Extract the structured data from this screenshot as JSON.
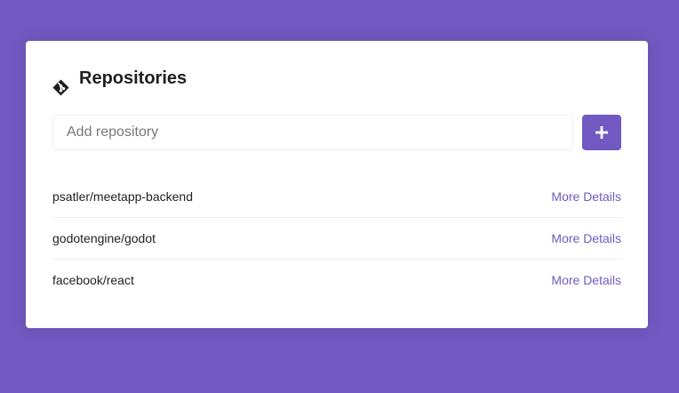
{
  "colors": {
    "background": "#7159c1",
    "accent": "#7159c1",
    "card": "#ffffff"
  },
  "header": {
    "icon": "git-icon",
    "title": "Repositories"
  },
  "form": {
    "placeholder": "Add repository",
    "value": "",
    "submit_icon": "plus-icon"
  },
  "repositories": [
    {
      "name": "psatler/meetapp-backend",
      "link_label": "More Details"
    },
    {
      "name": "godotengine/godot",
      "link_label": "More Details"
    },
    {
      "name": "facebook/react",
      "link_label": "More Details"
    }
  ]
}
